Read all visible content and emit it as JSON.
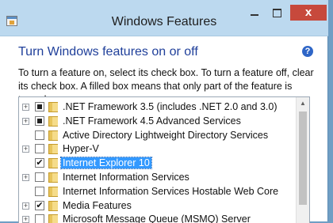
{
  "window": {
    "title": "Windows Features",
    "close_label": "x"
  },
  "heading": "Turn Windows features on or off",
  "help_label": "?",
  "description": "To turn a feature on, select its check box. To turn a feature off, clear its check box. A filled box means that only part of the feature is turned on.",
  "features": [
    {
      "label": ".NET Framework 3.5 (includes .NET 2.0 and 3.0)",
      "expandable": true,
      "state": "partial",
      "selected": false
    },
    {
      "label": ".NET Framework 4.5 Advanced Services",
      "expandable": true,
      "state": "partial",
      "selected": false
    },
    {
      "label": "Active Directory Lightweight Directory Services",
      "expandable": false,
      "state": "unchecked",
      "selected": false
    },
    {
      "label": "Hyper-V",
      "expandable": true,
      "state": "unchecked",
      "selected": false
    },
    {
      "label": "Internet Explorer 10",
      "expandable": false,
      "state": "checked",
      "selected": true
    },
    {
      "label": "Internet Information Services",
      "expandable": true,
      "state": "unchecked",
      "selected": false
    },
    {
      "label": "Internet Information Services Hostable Web Core",
      "expandable": false,
      "state": "unchecked",
      "selected": false
    },
    {
      "label": "Media Features",
      "expandable": true,
      "state": "checked",
      "selected": false
    },
    {
      "label": "Microsoft Message Queue (MSMQ) Server",
      "expandable": true,
      "state": "unchecked",
      "selected": false
    }
  ],
  "icons": {
    "app": "windows-features-icon",
    "folder": "folder-icon",
    "expand": "plus-icon",
    "help": "help-icon"
  },
  "colors": {
    "titlebar": "#bcd9ef",
    "close_button": "#c7493c",
    "heading": "#1f3f9a",
    "selection": "#3399ff"
  }
}
